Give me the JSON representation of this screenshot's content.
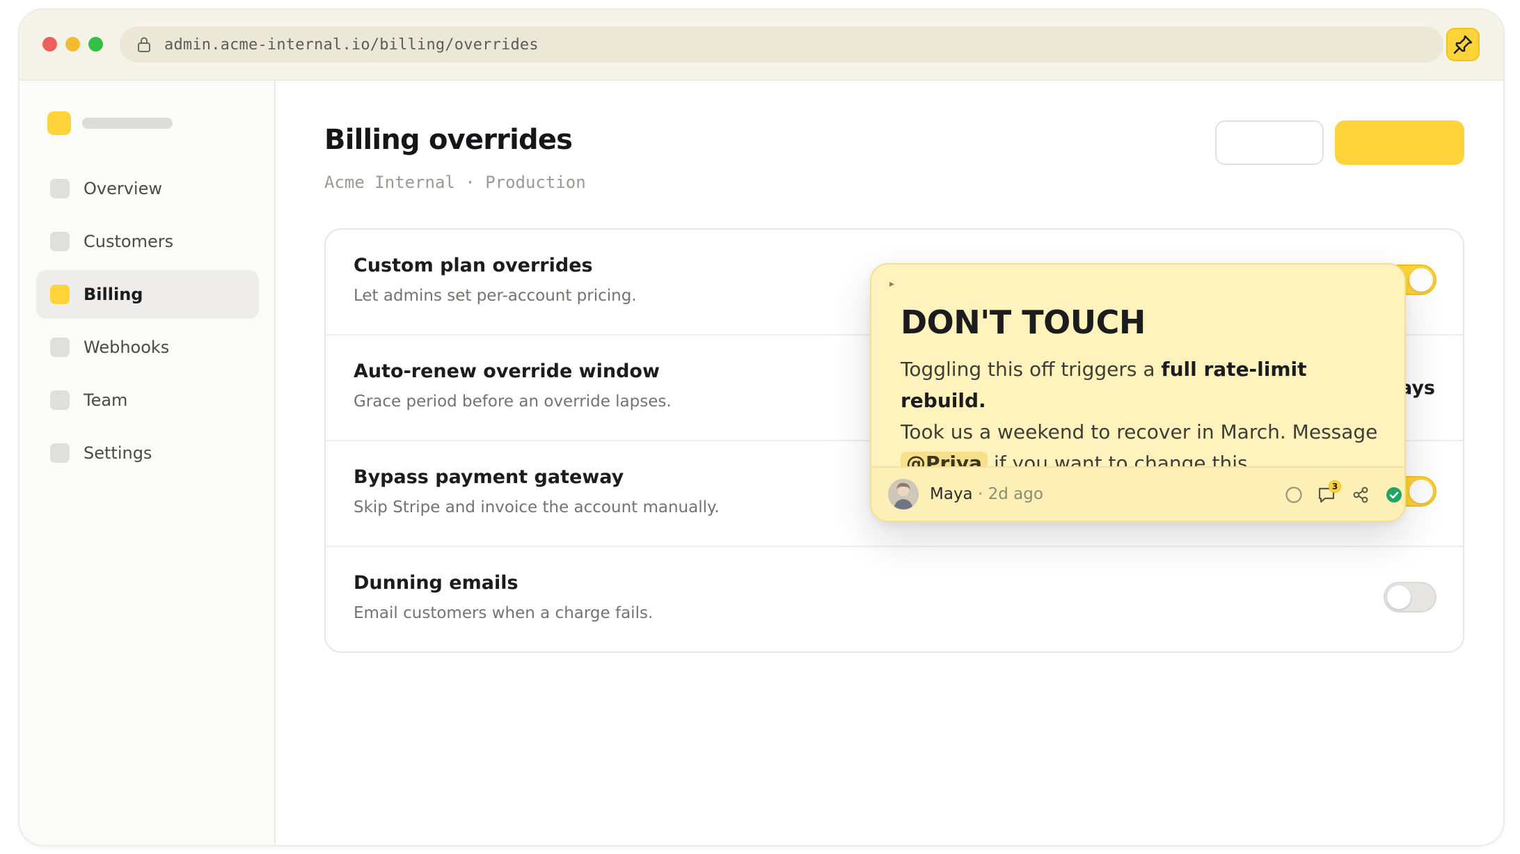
{
  "browser": {
    "url": "admin.acme-internal.io/billing/overrides",
    "icons": [
      "lock-icon",
      "pin-extension-icon"
    ]
  },
  "sidebar": {
    "items": [
      {
        "label": "Overview",
        "active": false
      },
      {
        "label": "Customers",
        "active": false
      },
      {
        "label": "Billing",
        "active": true
      },
      {
        "label": "Webhooks",
        "active": false
      },
      {
        "label": "Team",
        "active": false
      },
      {
        "label": "Settings",
        "active": false
      }
    ]
  },
  "header": {
    "title": "Billing overrides",
    "subtitle": "Acme Internal · Production"
  },
  "settings": {
    "rows": [
      {
        "title": "Custom plan overrides",
        "description": "Let admins set per-account pricing.",
        "control": "toggle",
        "on": true
      },
      {
        "title": "Auto-renew override window",
        "description": "Grace period before an override lapses.",
        "control": "value",
        "value": "ays"
      },
      {
        "title": "Bypass payment gateway",
        "description": "Skip Stripe and invoice the account manually.",
        "control": "toggle",
        "on": true
      },
      {
        "title": "Dunning emails",
        "description": "Email customers when a charge fails.",
        "control": "toggle",
        "on": false
      }
    ]
  },
  "note": {
    "caret": "▸",
    "title": "DON'T TOUCH",
    "body_1": "Toggling this off triggers a ",
    "body_bold": "full rate-limit rebuild.",
    "body_2": "Took us a weekend to recover in March. Message",
    "mention": "@Priya",
    "body_3": " if you want to change this.",
    "author": "Maya",
    "time": " · 2d ago",
    "comment_count": "3"
  },
  "colors": {
    "accent": "#ffd43b",
    "note_bg": "#fef3bd",
    "resolved": "#1fa463"
  }
}
